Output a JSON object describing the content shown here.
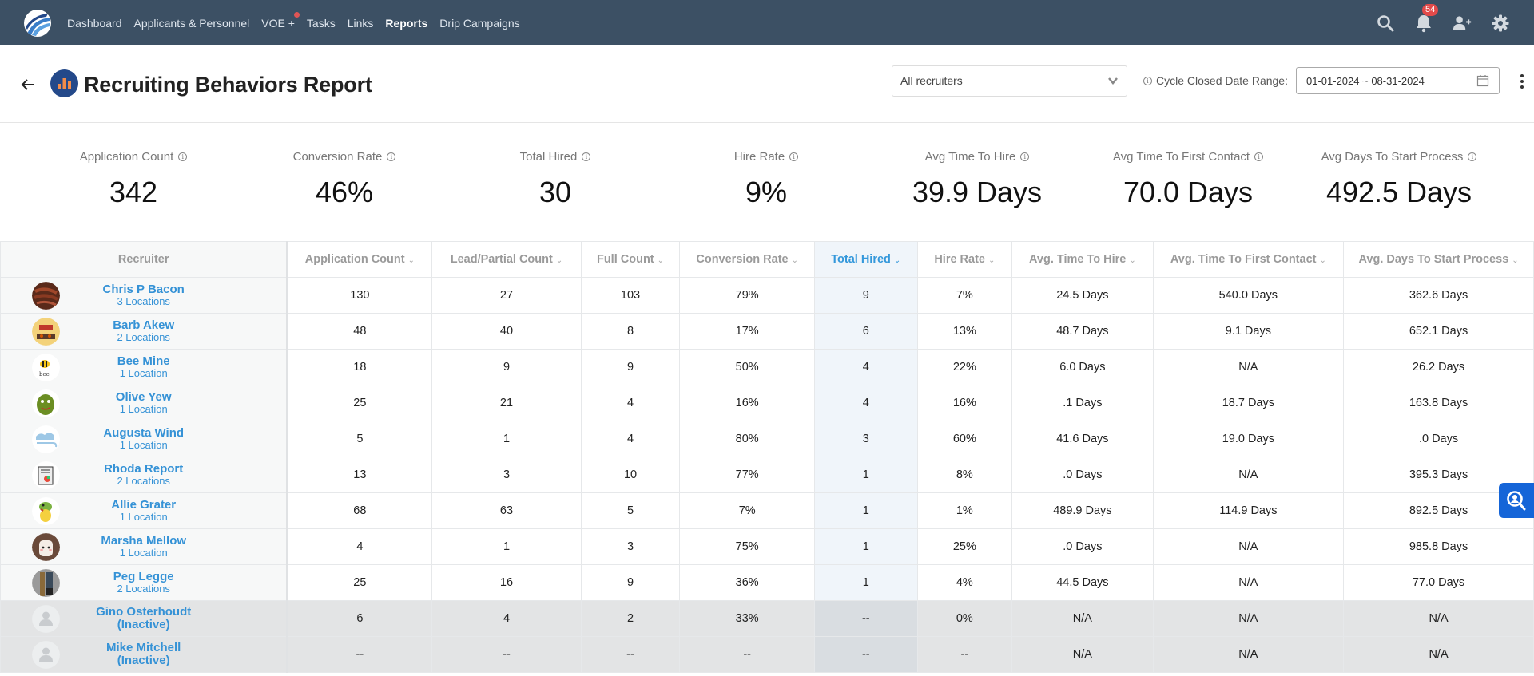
{
  "nav": {
    "items": [
      {
        "label": "Dashboard",
        "active": false
      },
      {
        "label": "Applicants & Personnel",
        "active": false
      },
      {
        "label": "VOE +",
        "active": false,
        "dot": true
      },
      {
        "label": "Tasks",
        "active": false
      },
      {
        "label": "Links",
        "active": false
      },
      {
        "label": "Reports",
        "active": true
      },
      {
        "label": "Drip Campaigns",
        "active": false
      }
    ],
    "notification_count": "54",
    "icons": [
      "search-icon",
      "bell-icon",
      "add-user-icon",
      "gear-icon"
    ]
  },
  "header": {
    "title": "Recruiting Behaviors Report",
    "recruiter_filter": "All recruiters",
    "date_range_label": "Cycle Closed Date Range:",
    "date_range_value": "01-01-2024 ~ 08-31-2024"
  },
  "kpis": [
    {
      "label": "Application Count",
      "value": "342"
    },
    {
      "label": "Conversion Rate",
      "value": "46%"
    },
    {
      "label": "Total Hired",
      "value": "30"
    },
    {
      "label": "Hire Rate",
      "value": "9%"
    },
    {
      "label": "Avg Time To Hire",
      "value": "39.9 Days"
    },
    {
      "label": "Avg Time To First Contact",
      "value": "70.0 Days"
    },
    {
      "label": "Avg Days To Start Process",
      "value": "492.5 Days"
    }
  ],
  "table": {
    "columns": [
      {
        "label": "Recruiter"
      },
      {
        "label": "Application Count"
      },
      {
        "label": "Lead/Partial Count"
      },
      {
        "label": "Full Count"
      },
      {
        "label": "Conversion Rate"
      },
      {
        "label": "Total Hired",
        "sorted": true
      },
      {
        "label": "Hire Rate"
      },
      {
        "label": "Avg. Time To Hire"
      },
      {
        "label": "Avg. Time To First Contact"
      },
      {
        "label": "Avg. Days To Start Process"
      }
    ],
    "rows": [
      {
        "name": "Chris P Bacon",
        "sub": "3 Locations",
        "avatar": "bacon",
        "inactive": false,
        "cells": [
          "130",
          "27",
          "103",
          "79%",
          "9",
          "7%",
          "24.5 Days",
          "540.0 Days",
          "362.6 Days"
        ]
      },
      {
        "name": "Barb Akew",
        "sub": "2 Locations",
        "avatar": "bbq",
        "inactive": false,
        "cells": [
          "48",
          "40",
          "8",
          "17%",
          "6",
          "13%",
          "48.7 Days",
          "9.1 Days",
          "652.1 Days"
        ]
      },
      {
        "name": "Bee Mine",
        "sub": "1 Location",
        "avatar": "bee",
        "inactive": false,
        "cells": [
          "18",
          "9",
          "9",
          "50%",
          "4",
          "22%",
          "6.0 Days",
          "N/A",
          "26.2 Days"
        ]
      },
      {
        "name": "Olive Yew",
        "sub": "1 Location",
        "avatar": "olive",
        "inactive": false,
        "cells": [
          "25",
          "21",
          "4",
          "16%",
          "4",
          "16%",
          ".1 Days",
          "18.7 Days",
          "163.8 Days"
        ]
      },
      {
        "name": "Augusta Wind",
        "sub": "1 Location",
        "avatar": "wind",
        "inactive": false,
        "cells": [
          "5",
          "1",
          "4",
          "80%",
          "3",
          "60%",
          "41.6 Days",
          "19.0 Days",
          ".0 Days"
        ]
      },
      {
        "name": "Rhoda Report",
        "sub": "2 Locations",
        "avatar": "report",
        "inactive": false,
        "cells": [
          "13",
          "3",
          "10",
          "77%",
          "1",
          "8%",
          ".0 Days",
          "N/A",
          "395.3 Days"
        ]
      },
      {
        "name": "Allie Grater",
        "sub": "1 Location",
        "avatar": "gator",
        "inactive": false,
        "cells": [
          "68",
          "63",
          "5",
          "7%",
          "1",
          "1%",
          "489.9 Days",
          "114.9 Days",
          "892.5 Days"
        ]
      },
      {
        "name": "Marsha Mellow",
        "sub": "1 Location",
        "avatar": "marshmallow",
        "inactive": false,
        "cells": [
          "4",
          "1",
          "3",
          "75%",
          "1",
          "25%",
          ".0 Days",
          "N/A",
          "985.8 Days"
        ]
      },
      {
        "name": "Peg Legge",
        "sub": "2 Locations",
        "avatar": "pegleg",
        "inactive": false,
        "cells": [
          "25",
          "16",
          "9",
          "36%",
          "1",
          "4%",
          "44.5 Days",
          "N/A",
          "77.0 Days"
        ]
      },
      {
        "name": "Gino Osterhoudt",
        "sub": "(Inactive)",
        "avatar": "placeholder",
        "inactive": true,
        "cells": [
          "6",
          "4",
          "2",
          "33%",
          "--",
          "0%",
          "N/A",
          "N/A",
          "N/A"
        ]
      },
      {
        "name": "Mike Mitchell",
        "sub": "(Inactive)",
        "avatar": "placeholder",
        "inactive": true,
        "cells": [
          "--",
          "--",
          "--",
          "--",
          "--",
          "--",
          "N/A",
          "N/A",
          "N/A"
        ]
      }
    ]
  },
  "colors": {
    "nav_bg": "#3c5064",
    "link_blue": "#3592d6",
    "sorted_col_bg": "#f0f5fa",
    "badge_red": "#e24a4a",
    "title_icon_bg": "#24498a",
    "title_icon_bars": "#f28c4a",
    "floating_button": "#1565d8"
  }
}
